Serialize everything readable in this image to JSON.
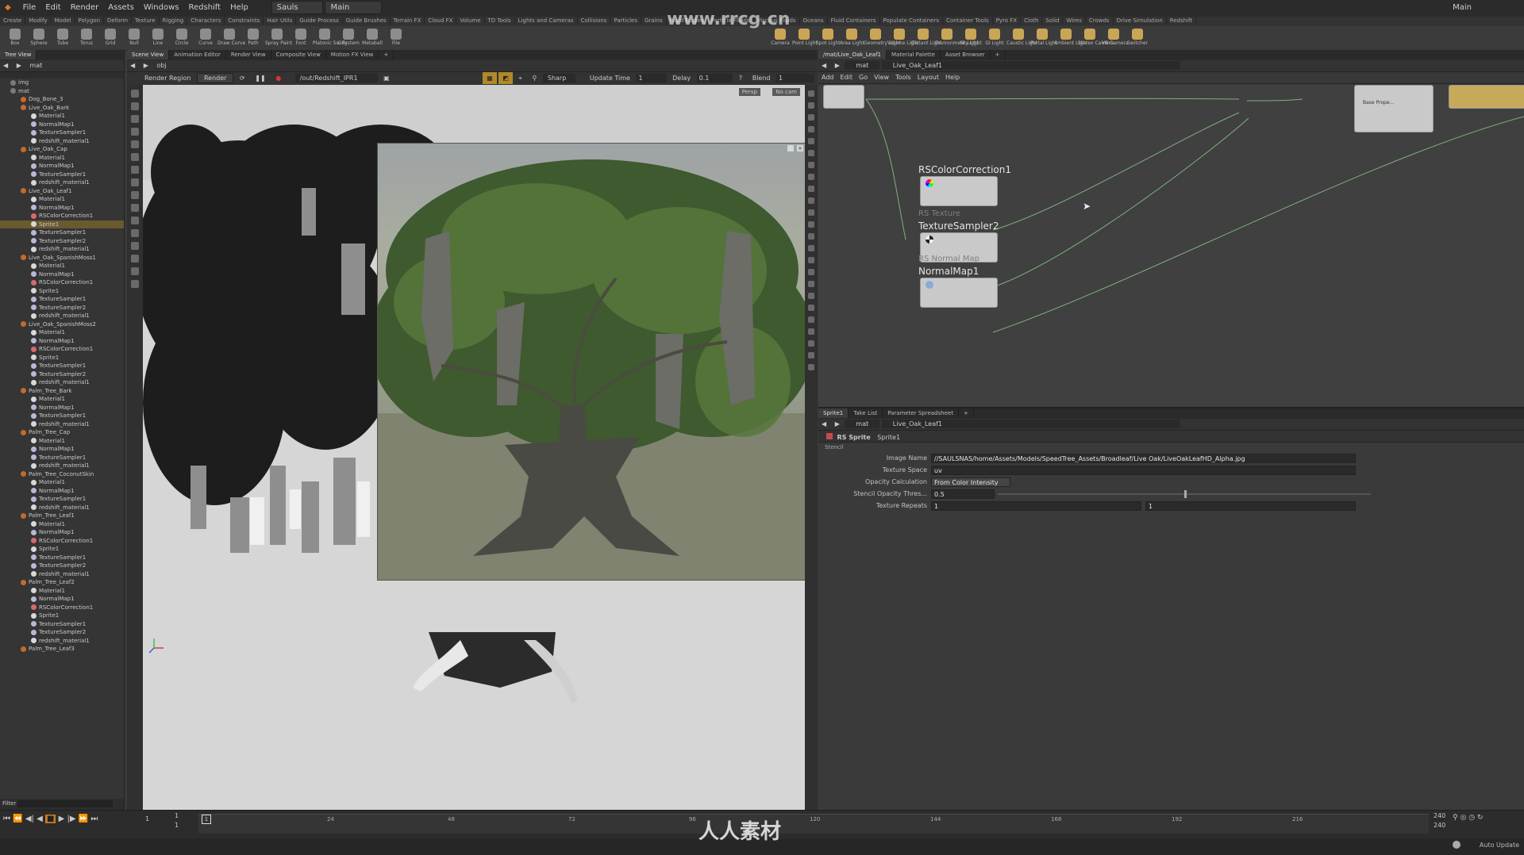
{
  "menu": [
    "File",
    "Edit",
    "Render",
    "Assets",
    "Windows",
    "Redshift",
    "Help"
  ],
  "desktop_label": "Sauls",
  "desktop_main": "Main",
  "main_label_right": "Main",
  "shelf_tabs": [
    "Create",
    "Modify",
    "Model",
    "Polygon",
    "Deform",
    "Texture",
    "Rigging",
    "Characters",
    "Constraints",
    "Hair Utils",
    "Guide Process",
    "Guide Brushes",
    "Terrain FX",
    "Cloud FX",
    "Volume",
    "TD Tools",
    "Lights and Cameras",
    "Collisions",
    "Particles",
    "Grains",
    "Rigid Bodies",
    "Particle Fluids",
    "Viscous Fluids",
    "Oceans",
    "Fluid Containers",
    "Populate Containers",
    "Container Tools",
    "Pyro FX",
    "Cloth",
    "Solid",
    "Wires",
    "Crowds",
    "Drive Simulation",
    "Redshift"
  ],
  "shelf_tools_left": [
    "Box",
    "Sphere",
    "Tube",
    "Torus",
    "Grid",
    "Null",
    "Line",
    "Circle",
    "Curve",
    "Draw Curve",
    "Path",
    "Spray Paint",
    "Font",
    "Platonic Solids",
    "L-System",
    "Metaball",
    "File"
  ],
  "shelf_tools_right": [
    "Camera",
    "Point Light",
    "Spot Light",
    "Area Light",
    "Geometry Light",
    "Volume Light",
    "Distant Light",
    "Environment Light",
    "Sky Light",
    "GI Light",
    "Caustic Light",
    "Portal Light",
    "Ambient Light",
    "Stereo Camera",
    "VR Camera",
    "Switcher"
  ],
  "tree": {
    "tab": "Tree View",
    "path": "mat",
    "filter_label": "Filter",
    "rows": [
      {
        "label": "img",
        "depth": 1,
        "type": "folder"
      },
      {
        "label": "mat",
        "depth": 1,
        "type": "folder"
      },
      {
        "label": "Dog_Bone_3",
        "depth": 2,
        "type": "net"
      },
      {
        "label": "Live_Oak_Bark",
        "depth": 2,
        "type": "net"
      },
      {
        "label": "Material1",
        "depth": 3,
        "type": "mat"
      },
      {
        "label": "NormalMap1",
        "depth": 3,
        "type": "tex"
      },
      {
        "label": "TextureSampler1",
        "depth": 3,
        "type": "tex"
      },
      {
        "label": "redshift_material1",
        "depth": 3,
        "type": "mat"
      },
      {
        "label": "Live_Oak_Cap",
        "depth": 2,
        "type": "net"
      },
      {
        "label": "Material1",
        "depth": 3,
        "type": "mat"
      },
      {
        "label": "NormalMap1",
        "depth": 3,
        "type": "tex"
      },
      {
        "label": "TextureSampler1",
        "depth": 3,
        "type": "tex"
      },
      {
        "label": "redshift_material1",
        "depth": 3,
        "type": "mat"
      },
      {
        "label": "Live_Oak_Leaf1",
        "depth": 2,
        "type": "net"
      },
      {
        "label": "Material1",
        "depth": 3,
        "type": "mat"
      },
      {
        "label": "NormalMap1",
        "depth": 3,
        "type": "tex"
      },
      {
        "label": "RSColorCorrection1",
        "depth": 3,
        "type": "cc"
      },
      {
        "label": "Sprite1",
        "depth": 3,
        "type": "mat",
        "selected": true
      },
      {
        "label": "TextureSampler1",
        "depth": 3,
        "type": "tex"
      },
      {
        "label": "TextureSampler2",
        "depth": 3,
        "type": "tex"
      },
      {
        "label": "redshift_material1",
        "depth": 3,
        "type": "mat"
      },
      {
        "label": "Live_Oak_SpanishMoss1",
        "depth": 2,
        "type": "net"
      },
      {
        "label": "Material1",
        "depth": 3,
        "type": "mat"
      },
      {
        "label": "NormalMap1",
        "depth": 3,
        "type": "tex"
      },
      {
        "label": "RSColorCorrection1",
        "depth": 3,
        "type": "cc"
      },
      {
        "label": "Sprite1",
        "depth": 3,
        "type": "mat"
      },
      {
        "label": "TextureSampler1",
        "depth": 3,
        "type": "tex"
      },
      {
        "label": "TextureSampler2",
        "depth": 3,
        "type": "tex"
      },
      {
        "label": "redshift_material1",
        "depth": 3,
        "type": "mat"
      },
      {
        "label": "Live_Oak_SpanishMoss2",
        "depth": 2,
        "type": "net"
      },
      {
        "label": "Material1",
        "depth": 3,
        "type": "mat"
      },
      {
        "label": "NormalMap1",
        "depth": 3,
        "type": "tex"
      },
      {
        "label": "RSColorCorrection1",
        "depth": 3,
        "type": "cc"
      },
      {
        "label": "Sprite1",
        "depth": 3,
        "type": "mat"
      },
      {
        "label": "TextureSampler1",
        "depth": 3,
        "type": "tex"
      },
      {
        "label": "TextureSampler2",
        "depth": 3,
        "type": "tex"
      },
      {
        "label": "redshift_material1",
        "depth": 3,
        "type": "mat"
      },
      {
        "label": "Palm_Tree_Bark",
        "depth": 2,
        "type": "net"
      },
      {
        "label": "Material1",
        "depth": 3,
        "type": "mat"
      },
      {
        "label": "NormalMap1",
        "depth": 3,
        "type": "tex"
      },
      {
        "label": "TextureSampler1",
        "depth": 3,
        "type": "tex"
      },
      {
        "label": "redshift_material1",
        "depth": 3,
        "type": "mat"
      },
      {
        "label": "Palm_Tree_Cap",
        "depth": 2,
        "type": "net"
      },
      {
        "label": "Material1",
        "depth": 3,
        "type": "mat"
      },
      {
        "label": "NormalMap1",
        "depth": 3,
        "type": "tex"
      },
      {
        "label": "TextureSampler1",
        "depth": 3,
        "type": "tex"
      },
      {
        "label": "redshift_material1",
        "depth": 3,
        "type": "mat"
      },
      {
        "label": "Palm_Tree_CoconutSkin",
        "depth": 2,
        "type": "net"
      },
      {
        "label": "Material1",
        "depth": 3,
        "type": "mat"
      },
      {
        "label": "NormalMap1",
        "depth": 3,
        "type": "tex"
      },
      {
        "label": "TextureSampler1",
        "depth": 3,
        "type": "tex"
      },
      {
        "label": "redshift_material1",
        "depth": 3,
        "type": "mat"
      },
      {
        "label": "Palm_Tree_Leaf1",
        "depth": 2,
        "type": "net"
      },
      {
        "label": "Material1",
        "depth": 3,
        "type": "mat"
      },
      {
        "label": "NormalMap1",
        "depth": 3,
        "type": "tex"
      },
      {
        "label": "RSColorCorrection1",
        "depth": 3,
        "type": "cc"
      },
      {
        "label": "Sprite1",
        "depth": 3,
        "type": "mat"
      },
      {
        "label": "TextureSampler1",
        "depth": 3,
        "type": "tex"
      },
      {
        "label": "TextureSampler2",
        "depth": 3,
        "type": "tex"
      },
      {
        "label": "redshift_material1",
        "depth": 3,
        "type": "mat"
      },
      {
        "label": "Palm_Tree_Leaf2",
        "depth": 2,
        "type": "net"
      },
      {
        "label": "Material1",
        "depth": 3,
        "type": "mat"
      },
      {
        "label": "NormalMap1",
        "depth": 3,
        "type": "tex"
      },
      {
        "label": "RSColorCorrection1",
        "depth": 3,
        "type": "cc"
      },
      {
        "label": "Sprite1",
        "depth": 3,
        "type": "mat"
      },
      {
        "label": "TextureSampler1",
        "depth": 3,
        "type": "tex"
      },
      {
        "label": "TextureSampler2",
        "depth": 3,
        "type": "tex"
      },
      {
        "label": "redshift_material1",
        "depth": 3,
        "type": "mat"
      },
      {
        "label": "Palm_Tree_Leaf3",
        "depth": 2,
        "type": "net"
      }
    ]
  },
  "viewport": {
    "tabs": [
      "Scene View",
      "Animation Editor",
      "Render View",
      "Composite View",
      "Motion FX View"
    ],
    "path": "obj",
    "render_region_label": "Render Region",
    "render_button": "Render",
    "rop_path": "/out/Redshift_IPR1",
    "filter_mode": "Sharp",
    "update_time_label": "Update Time",
    "update_time_value": "1",
    "delay_label": "Delay",
    "delay_value": "0.1",
    "blend_label": "Blend",
    "blend_value": "1",
    "persp_label": "Persp",
    "cam_label": "No cam"
  },
  "network": {
    "tabs": [
      "/mat/Live_Oak_Leaf1",
      "Material Palette",
      "Asset Browser"
    ],
    "path_root": "mat",
    "path_node": "Live_Oak_Leaf1",
    "menu": [
      "Add",
      "Edit",
      "Go",
      "View",
      "Tools",
      "Layout",
      "Help"
    ],
    "nodes": {
      "cc": {
        "title": "RSColorCorrection1",
        "sub": ""
      },
      "tex": {
        "title": "TextureSampler2",
        "sub": "RS Texture"
      },
      "nrm": {
        "title": "NormalMap1",
        "sub": "RS Normal Map"
      },
      "mat_port_label": "Base Prope..."
    }
  },
  "params": {
    "tabs": [
      "Sprite1",
      "Take List",
      "Parameter Spreadsheet"
    ],
    "path_root": "mat",
    "path_node": "Live_Oak_Leaf1",
    "node_type": "RS Sprite",
    "node_name": "Sprite1",
    "section": "Stencil",
    "fields": [
      {
        "label": "Image Name",
        "value": "//SAULSNAS/home/Assets/Models/SpeedTree_Assets/Broadleaf/Live Oak/LiveOakLeafHD_Alpha.jpg"
      },
      {
        "label": "Texture Space",
        "value": "uv"
      },
      {
        "label": "Opacity Calculation",
        "value": "From Color Intensity"
      },
      {
        "label": "Stencil Opacity Thres...",
        "value": "0.5",
        "slider": 0.5
      },
      {
        "label": "Texture Repeats",
        "value": "1",
        "value2": "1"
      }
    ]
  },
  "timeline": {
    "current_frame": "1",
    "start_frame": "1",
    "start_frame2": "1",
    "ticks": [
      "24",
      "48",
      "72",
      "96",
      "120",
      "144",
      "168",
      "192",
      "216"
    ],
    "end_frame": "240",
    "end_frame2": "240",
    "auto_update": "Auto Update"
  },
  "watermarks": {
    "top": "www.rrcg.cn",
    "bottom": "人人素材"
  },
  "colors": {
    "accent_selected": "#6b5a2f",
    "stop_button": "#d07a1e",
    "ipr_stop": "#d33a2f"
  }
}
